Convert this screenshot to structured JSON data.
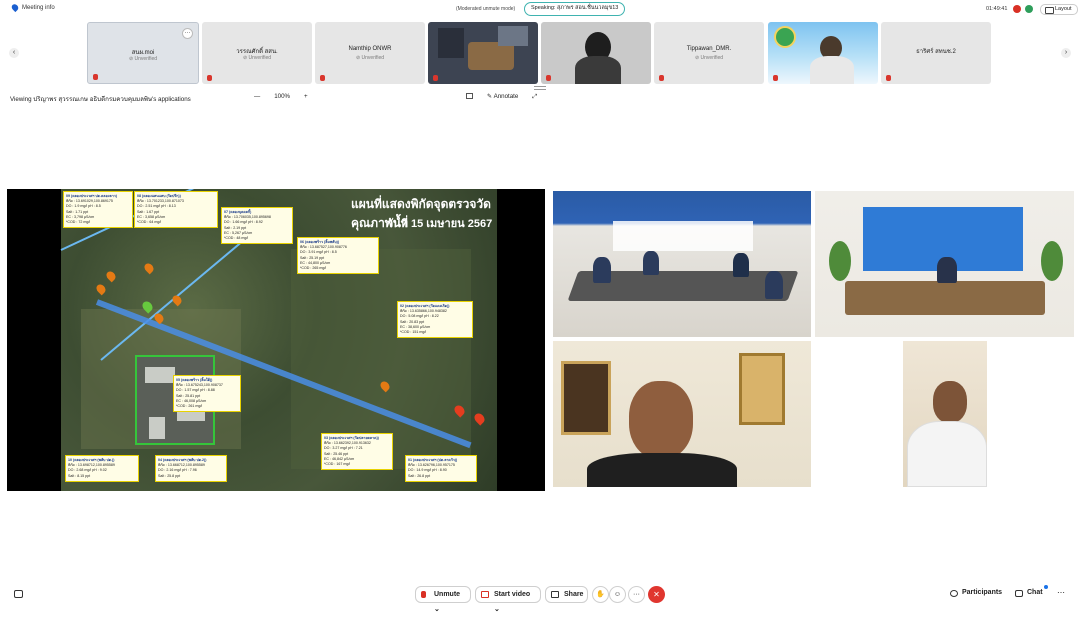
{
  "topbar": {
    "meeting_info": "Meeting info",
    "mode": "(Moderated unmute mode)",
    "speaking": "Speaking: สุภาพร สอน.ชื่นนวลมุข13",
    "clock": "01:49:41",
    "layout_label": "Layout",
    "rec_colors": [
      "#d93025",
      "#2e9e5b"
    ]
  },
  "tiles": [
    {
      "name": "สนผ.moi",
      "status": "Unverified",
      "type": "name",
      "active": true
    },
    {
      "name": "วรรณศักดิ์ สสน.",
      "status": "Unverified",
      "type": "name"
    },
    {
      "name": "Namthip ONWR",
      "status": "Unverified",
      "type": "name"
    },
    {
      "name": "",
      "status": "",
      "type": "video"
    },
    {
      "name": "",
      "status": "",
      "type": "video"
    },
    {
      "name": "Tippawan_DMR.",
      "status": "Unverified",
      "type": "name"
    },
    {
      "name": "",
      "status": "",
      "type": "video"
    },
    {
      "name": "ธาริศร์ สทนช.2",
      "status": "",
      "type": "name"
    }
  ],
  "share_bar": {
    "viewing": "Viewing ปริญาพร สุวรรณเกษ อธิบดีกรมควบคุมมลพิษ's applications",
    "zoom_minus": "—",
    "zoom": "100%",
    "zoom_plus": "+",
    "annotate": "Annotate"
  },
  "map": {
    "title": "แผนที่แสดงพิกัดจุดตรวจวัดคุณภาพน้ำ",
    "subtitle": "วันที่ 15 เมษายน 2567",
    "labels": [
      {
        "head": "09 (คลองประเวศฯ ปต.คลองลาว)",
        "lines": [
          "พิกัด : 13.691029,100.869175",
          "DO : 1.9 mg/l  pH : 8.5",
          "Salt : 1.71 ppt",
          "EC : 3,798 µS/cm",
          "*COD : 72 mg/l"
        ]
      },
      {
        "head": "08 (คลองแสนแสบ (วัดปรึก))",
        "lines": [
          "พิกัด : 13.701233,100.871073",
          "DO : 2.51 mg/l  pH : 8.13",
          "Salt : 1.67 ppt",
          "EC : 3,658 µS/cm",
          "*COD : 64 mg/l"
        ]
      },
      {
        "head": "07 (คลองบุคคลกี้)",
        "lines": [
          "พิกัด : 13.706035,100.895698",
          "DO : 1.66 mg/l  pH : 8.92",
          "Salt : 2.19 ppt",
          "EC : 5,267 µS/cm",
          "*COD : 48 mg/l"
        ]
      },
      {
        "head": "06 (คลองพร้าว (ลิ้มพลับ))",
        "lines": [
          "พิกัด : 13.687527,100.908776",
          "DO : 3.91 mg/l  pH : 8.5",
          "Salt : 25.19 ppt",
          "EC : 44,800 µS/cm",
          "*COD : 265 mg/l"
        ]
      },
      {
        "head": "02 (คลองประเวศฯ (วัดแดงเกิด))",
        "lines": [
          "พิกัด : 13.635866,100.948382",
          "DO : 5.08 mg/l  pH : 8.22",
          "Salt : 20.83 ppt",
          "EC : 38,600 µS/cm",
          "*COD : 151 mg/l"
        ]
      },
      {
        "head": "05 (คลองพร้าว (ลิ้มใต้))",
        "lines": [
          "พิกัด : 13.675243,100.908737",
          "DO : 1.57 mg/l  pH : 8.88",
          "Salt : 25.81 ppt",
          "EC : 46,008 µS/cm",
          "*COD : 261 mg/l"
        ]
      },
      {
        "head": "03 (คลองประเวศฯ (วัดปลายตลาด))",
        "lines": [
          "พิกัด : 13.662392,100.913632",
          "DO : 3.27 mg/l  pH : 7.21",
          "Salt : 25.46 ppt",
          "EC : 46,842 µS/cm",
          "*COD : 167 mg/l"
        ]
      },
      {
        "head": "01 (คลองประเวศฯ (ปต.ลาดวัว))",
        "lines": [
          "พิกัด : 13.626796,100.957175",
          "DO : 14.9 mg/l  pH : 8.90",
          "Salt : 26.8 ppt"
        ]
      },
      {
        "head": "10 (คลองประเวศฯ (พลับ ปต.))",
        "lines": [
          "พิกัด : 13.698712,100.895589",
          "DO : 2.68 mg/l  pH : 9.02",
          "Salt : 8.15 ppt"
        ]
      },
      {
        "head": "04 (คลองประเวศฯ (พลับ ปต.2))",
        "lines": [
          "พิกัด : 13.668712,100.895589",
          "DO : 2.16 mg/l  pH : 7.96",
          "Salt : 25.8 ppt"
        ]
      }
    ],
    "markers": [
      "9",
      "8",
      "7",
      "6",
      "10",
      "3",
      "2",
      "1",
      "5",
      "4"
    ]
  },
  "toolbar": {
    "unmute": "Unmute",
    "start_video": "Start video",
    "share": "Share",
    "more": "···",
    "participants": "Participants",
    "chat": "Chat"
  }
}
